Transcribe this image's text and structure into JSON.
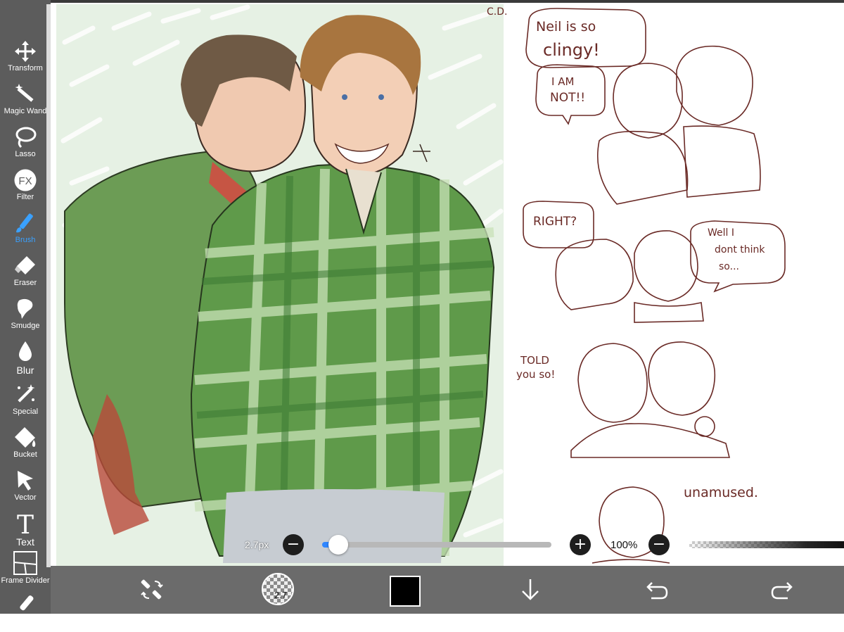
{
  "sidebar": {
    "tools": [
      {
        "label": "Transform",
        "icon": "move-arrows-icon"
      },
      {
        "label": "Magic Wand",
        "icon": "magic-wand-icon"
      },
      {
        "label": "Lasso",
        "icon": "lasso-icon"
      },
      {
        "label": "Filter",
        "icon": "fx-filter-icon"
      },
      {
        "label": "Brush",
        "icon": "brush-icon",
        "active": true
      },
      {
        "label": "Eraser",
        "icon": "eraser-icon"
      },
      {
        "label": "Smudge",
        "icon": "smudge-icon"
      },
      {
        "label": "Blur",
        "icon": "blur-drop-icon"
      },
      {
        "label": "Special",
        "icon": "special-wand-icon"
      },
      {
        "label": "Bucket",
        "icon": "bucket-icon"
      },
      {
        "label": "Vector",
        "icon": "vector-arrow-icon"
      },
      {
        "label": "Text",
        "icon": "text-t-icon"
      },
      {
        "label": "Frame Divider",
        "icon": "frame-divider-icon"
      }
    ],
    "active_color": "#3aa1ff"
  },
  "comic": {
    "caption": "C.D.",
    "bubbles": [
      {
        "text": "Neil is so"
      },
      {
        "text": "clingy!"
      },
      {
        "text": "I AM"
      },
      {
        "text": "NOT!!"
      },
      {
        "text": "RIGHT?"
      },
      {
        "text": "Well  I"
      },
      {
        "text": "dont think"
      },
      {
        "text": "so..."
      },
      {
        "text": "TOLD"
      },
      {
        "text": "you so!"
      },
      {
        "text": "unamused."
      }
    ]
  },
  "brush_controls": {
    "size_label": "2.7px",
    "size_fraction": 0.07,
    "zoom_label": "100%",
    "minus_symbol": "−",
    "plus_symbol": "+"
  },
  "bottom_toolbar": {
    "brush_size": "2.7",
    "current_color": "#000000",
    "items": [
      "swap-tool-icon",
      "brush-preview",
      "color-swatch",
      "download-arrow-icon",
      "undo-icon",
      "redo-icon"
    ]
  }
}
